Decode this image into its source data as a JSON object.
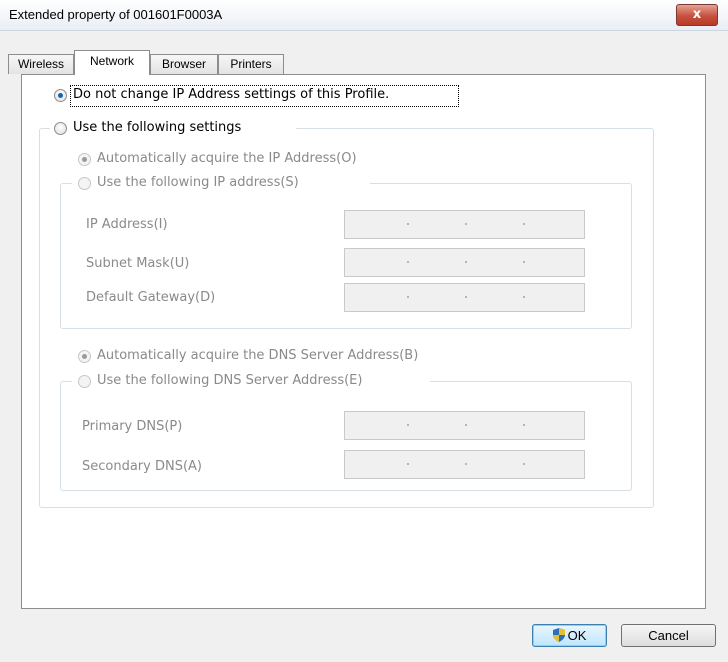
{
  "window": {
    "title": "Extended property of 001601F0003A",
    "close_label": "x"
  },
  "tabs": [
    "Wireless",
    "Network",
    "Browser",
    "Printers"
  ],
  "active_tab": "Network",
  "options": {
    "no_change": "Do not change IP Address settings of this Profile.",
    "use_following": "Use the following settings"
  },
  "ip_group": {
    "auto": "Automatically acquire the IP Address(O)",
    "manual": "Use the following IP address(S)",
    "fields": [
      {
        "label": "IP Address(I)",
        "value": ""
      },
      {
        "label": "Subnet Mask(U)",
        "value": ""
      },
      {
        "label": "Default Gateway(D)",
        "value": ""
      }
    ]
  },
  "dns_group": {
    "auto": "Automatically acquire the DNS Server Address(B)",
    "manual": "Use the following DNS Server Address(E)",
    "fields": [
      {
        "label": "Primary DNS(P)",
        "value": ""
      },
      {
        "label": "Secondary DNS(A)",
        "value": ""
      }
    ]
  },
  "buttons": {
    "ok": "OK",
    "cancel": "Cancel"
  },
  "colors": {
    "selected_radio": "#1a5fb4",
    "disabled_text": "#8a8a8a",
    "close_button": "#c6513f"
  }
}
